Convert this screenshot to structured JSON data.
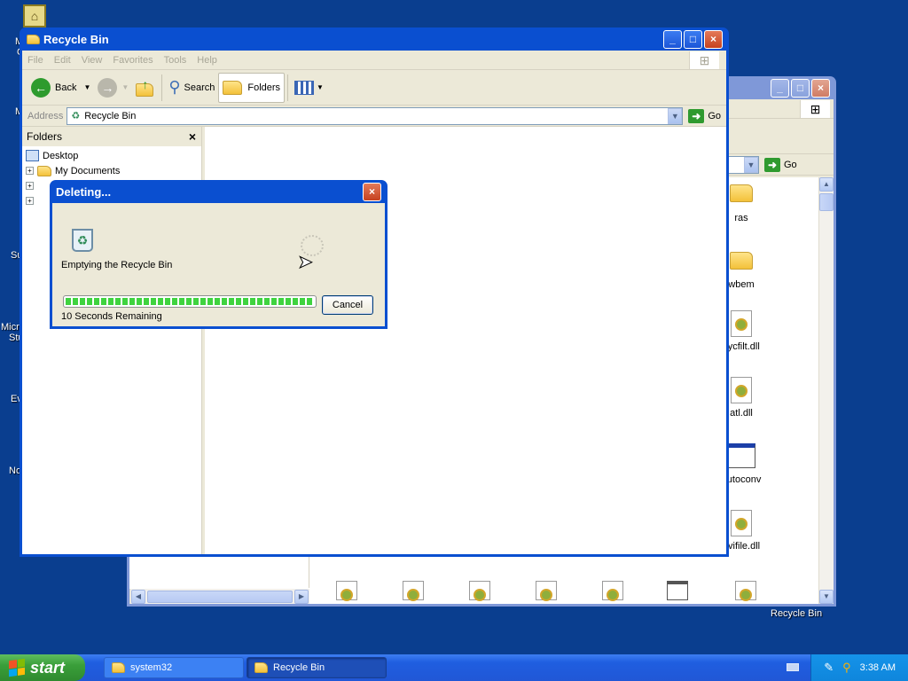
{
  "desktop": {
    "left_labels": [
      "M",
      "C",
      "M",
      "Su",
      "Micro",
      "Stu",
      "Ev",
      "No"
    ],
    "bottom_right_label": "Recycle Bin"
  },
  "back_window": {
    "title": "system32",
    "go_label": "Go",
    "items": [
      {
        "label": "ras",
        "icon": "folder-icon"
      },
      {
        "label": "wbem",
        "icon": "folder-icon"
      },
      {
        "label": "sycfilt.dll",
        "icon": "dll-file-icon"
      },
      {
        "label": "atl.dll",
        "icon": "dll-file-icon"
      },
      {
        "label": "autoconv",
        "icon": "application-icon"
      },
      {
        "label": "avifile.dll",
        "icon": "dll-file-icon"
      }
    ]
  },
  "front_window": {
    "title": "Recycle Bin",
    "menu": [
      "File",
      "Edit",
      "View",
      "Favorites",
      "Tools",
      "Help"
    ],
    "toolbar": {
      "back_label": "Back",
      "search_label": "Search",
      "folders_label": "Folders"
    },
    "address": {
      "label": "Address",
      "value": "Recycle Bin",
      "go_label": "Go"
    },
    "folders_pane": {
      "title": "Folders",
      "tree": [
        {
          "label": "Desktop"
        },
        {
          "label": "My Documents"
        }
      ]
    }
  },
  "dialog": {
    "title": "Deleting...",
    "message": "Emptying the Recycle Bin",
    "remaining": "10 Seconds Remaining",
    "cancel_label": "Cancel",
    "progress_fraction": 1.0
  },
  "taskbar": {
    "start_label": "start",
    "tasks": [
      {
        "label": "system32"
      },
      {
        "label": "Recycle Bin"
      }
    ],
    "clock": "3:38 AM"
  },
  "colors": {
    "desktop": "#0a3e8f",
    "title_active": "#0a4fd0",
    "progress": "#3fd33f",
    "taskbar": "#2157d6",
    "start": "#3a9f3a"
  }
}
